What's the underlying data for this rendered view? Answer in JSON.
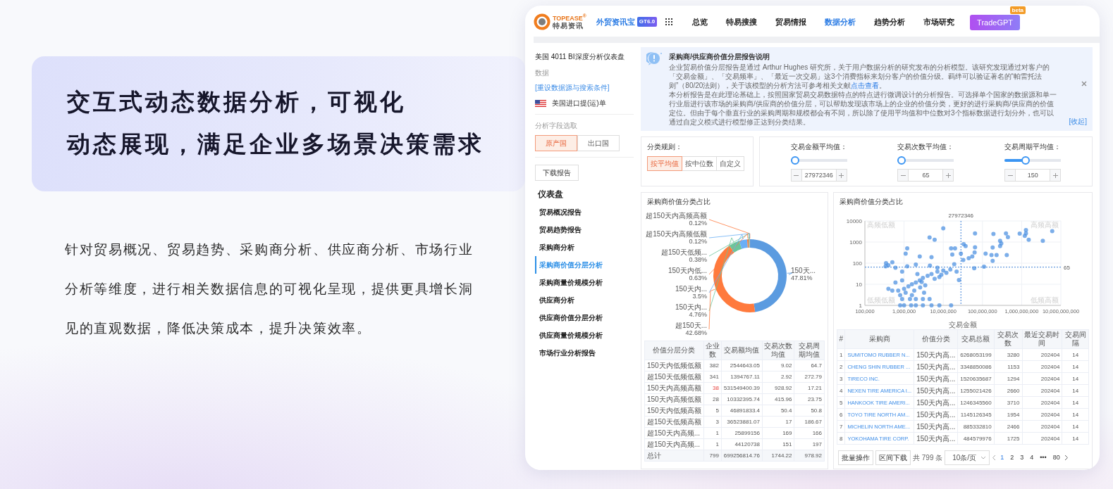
{
  "intro": {
    "headline": [
      "交互式动态数据分析，可视化",
      "动态展现，满足企业多场景决策需求"
    ],
    "body": "针对贸易概况、贸易趋势、采购商分析、供应商分析、市场行业分析等维度，进行相关数据信息的可视化呈现，提供更具增长洞见的直观数据，降低决策成本，提升决策效率。"
  },
  "app": {
    "logo": {
      "brand": "TOPEASE$^{®}$",
      "subtitle": "特易资讯"
    },
    "product": {
      "name": "外贸资讯宝",
      "badge": "GT6.0"
    },
    "nav": [
      {
        "label": "总览",
        "selected": false
      },
      {
        "label": "特易搜搜",
        "selected": false
      },
      {
        "label": "贸易情报",
        "selected": false
      },
      {
        "label": "数据分析",
        "selected": true
      },
      {
        "label": "趋势分析",
        "selected": false
      },
      {
        "label": "市场研究",
        "selected": false
      }
    ],
    "gpt_button": {
      "label": "TradeGPT",
      "badge": "beta"
    },
    "sidebar": {
      "title": "美国 4011 BI深度分析仪表盘",
      "data_label": "数据",
      "reset_link": "[重设数据源与搜索条件]",
      "source": "美国进口提(运)单",
      "field_label": "分析字段选取",
      "field_options": [
        {
          "label": "原产国",
          "selected": true
        },
        {
          "label": "出口国",
          "selected": false
        }
      ],
      "download_button": "下载报告",
      "section": "仪表盘",
      "items": [
        {
          "label": "贸易概况报告",
          "selected": false
        },
        {
          "label": "贸易趋势报告",
          "selected": false
        },
        {
          "label": "采购商分析",
          "selected": false
        },
        {
          "label": "采购商价值分层分析",
          "selected": true
        },
        {
          "label": "采购商量价规模分析",
          "selected": false
        },
        {
          "label": "供应商分析",
          "selected": false
        },
        {
          "label": "供应商价值分层分析",
          "selected": false
        },
        {
          "label": "供应商量价规模分析",
          "selected": false
        },
        {
          "label": "市场行业分析报告",
          "selected": false
        }
      ]
    },
    "notice": {
      "title": "采购商/供应商价值分层报告说明",
      "paragraphs": [
        {
          "text": "企业贸易价值分层报告是通过 Arthur Hughes 研究所，关于用户数据分析的研究发布的分析模型。该研究发现通过对客户的「交易金额」、「交易频率」、「最近一次交易」这3个消费指标来划分客户的价值分级。羁绊可以验证著名的“帕雷托法则”（80/20法则），关于该模型的分析方法可参考相关文献",
          "link": "点击查看",
          "after": "。"
        },
        {
          "text": "本分析报告是在此理论基础上，按照国家贸易交易数据特点的特点进行微调设计的分析报告。可选择单个国家的数据源和单一行业后进行该市场的采购商/供应商的价值分层，可以帮助发现该市场上的企业的价值分类，更好的进行采购商/供应商的价值定位。但由于每个垂直行业的采购周期和规模都会有不同，所以除了使用平均值和中位数对3个指标数据进行划分外，也可以通过自定义模式进行模型修正达到分类结果。"
        }
      ],
      "collapse_link": "[收起]"
    },
    "rule": {
      "label": "分类规则：",
      "options": [
        {
          "label": "按平均值",
          "selected": true
        },
        {
          "label": "按中位数",
          "selected": false
        },
        {
          "label": "自定义",
          "selected": false
        }
      ]
    },
    "sliders": [
      {
        "label": "交易金额平均值：",
        "level": 0,
        "value": "27972346"
      },
      {
        "label": "交易次数平均值：",
        "level": 0,
        "value": "65"
      },
      {
        "label": "交易周期平均值：",
        "level": 0.35,
        "value": "150"
      }
    ],
    "pie_card": {
      "chart_data": {
        "type": "donut",
        "title": "采购商价值分类占比",
        "categories": [
          "150天...",
          "超150天...",
          "150天内...",
          "150天内...",
          "150天内低...",
          "超150天低频...",
          "超150天内高频低额",
          "超150天内高频高额"
        ],
        "values": [
          47.81,
          42.68,
          4.76,
          3.5,
          0.63,
          0.38,
          0.12,
          0.12
        ],
        "value_labels": [
          "47.81%",
          "42.68%",
          "4.76%",
          "3.5%",
          "0.63%",
          "0.38%",
          "0.12%",
          "0.12%"
        ]
      },
      "table": {
        "columns": [
          "价值分层分类",
          "企业数",
          "交易额均值",
          "交易次数均值",
          "交易周期均值"
        ],
        "rows": [
          {
            "cells": [
              "150天内低频低额",
              "382",
              "2544643.05",
              "9.02",
              "64.7"
            ],
            "alert": false
          },
          {
            "cells": [
              "超150天低频低额",
              "341",
              "1394767.11",
              "2.92",
              "272.79"
            ],
            "alert": false
          },
          {
            "cells": [
              "150天内高频高额",
              "38",
              "531549400.39",
              "928.92",
              "17.21"
            ],
            "alert": true
          },
          {
            "cells": [
              "150天内高频低额",
              "28",
              "10332395.74",
              "415.96",
              "23.75"
            ],
            "alert": false
          },
          {
            "cells": [
              "150天内低频高额",
              "5",
              "46891833.4",
              "50.4",
              "50.8"
            ],
            "alert": false
          },
          {
            "cells": [
              "超150天低频高额",
              "3",
              "36523881.07",
              "17",
              "186.67"
            ],
            "alert": false
          },
          {
            "cells": [
              "超150天内高频...",
              "1",
              "25899156",
              "169",
              "166"
            ],
            "alert": false
          },
          {
            "cells": [
              "超150天内高频...",
              "1",
              "44120738",
              "151",
              "197"
            ],
            "alert": false
          }
        ],
        "total": [
          "总计",
          "799",
          "699256814.76",
          "1744.22",
          "978.92"
        ]
      }
    },
    "scatter_card": {
      "title": "采购商价值分类占比",
      "x_ticks": [
        "100,000",
        "1,000,000",
        "10,000,000",
        "100,000,000",
        "1,000,000,000",
        "10,000,000,000"
      ],
      "y_ticks": [
        "10000",
        "1000",
        "100",
        "10",
        "1"
      ],
      "x_title": "交易金额",
      "reference_labels": {
        "vertical": "27972346",
        "horizontal": "65"
      },
      "quadrant_labels": [
        "高频低额",
        "高频高额",
        "低频低额",
        "低频高额"
      ],
      "table": {
        "columns": [
          "#",
          "采购商",
          "价值分类",
          "交易总额",
          "交易次数",
          "最近交易时间",
          "交易间隔"
        ],
        "rows": [
          [
            "1",
            "SUMITOMO RUBBER N...",
            "150天内高...",
            "6268053199",
            "3280",
            "202404",
            "14"
          ],
          [
            "2",
            "CHENG SHIN RUBBER ...",
            "150天内高...",
            "3348850086",
            "1153",
            "202404",
            "14"
          ],
          [
            "3",
            "TIRECO INC.",
            "150天内高...",
            "1520635687",
            "1294",
            "202404",
            "14"
          ],
          [
            "4",
            "NEXEN TIRE AMERICA I...",
            "150天内高...",
            "1255021426",
            "2660",
            "202404",
            "14"
          ],
          [
            "5",
            "HANKOOK TIRE AMERI...",
            "150天内高...",
            "1246345560",
            "3710",
            "202404",
            "14"
          ],
          [
            "6",
            "TOYO TIRE NORTH AM...",
            "150天内高...",
            "1145126345",
            "1954",
            "202404",
            "14"
          ],
          [
            "7",
            "MICHELIN NORTH AME...",
            "150天内高...",
            "885332810",
            "2466",
            "202404",
            "14"
          ],
          [
            "8",
            "YOKOHAMA TIRE CORP.",
            "150天内高...",
            "484579976",
            "1725",
            "202404",
            "14"
          ]
        ]
      },
      "pagination": {
        "bulk_button": "批量操作",
        "range_button": "区间下载",
        "total": "共 799 条",
        "page_size": "10条/页",
        "pages": [
          {
            "kind": "page",
            "label": "1",
            "selected": true
          },
          {
            "kind": "page",
            "label": "2",
            "selected": false
          },
          {
            "kind": "page",
            "label": "3",
            "selected": false
          },
          {
            "kind": "page",
            "label": "4",
            "selected": false
          },
          {
            "kind": "ellipsis",
            "label": "•••"
          },
          {
            "kind": "page",
            "label": "80",
            "selected": false
          }
        ]
      }
    }
  }
}
